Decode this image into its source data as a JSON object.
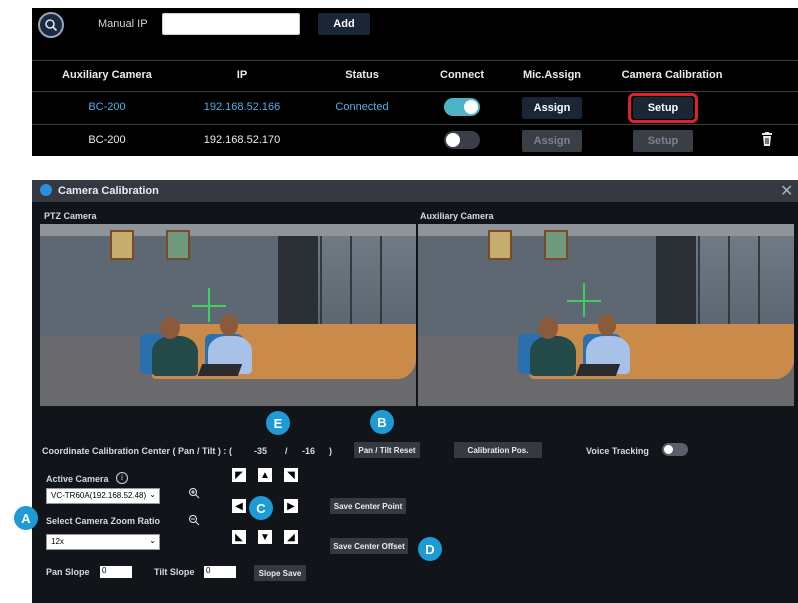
{
  "top_panel": {
    "manual_ip_label": "Manual IP",
    "manual_ip_value": "",
    "add_label": "Add",
    "columns": [
      "Auxiliary Camera",
      "IP",
      "Status",
      "Connect",
      "Mic.Assign",
      "Camera Calibration"
    ],
    "rows": [
      {
        "camera": "BC-200",
        "ip": "192.168.52.166",
        "status": "Connected",
        "connect": true,
        "assign": "Assign",
        "setup": "Setup"
      },
      {
        "camera": "BC-200",
        "ip": "192.168.52.170",
        "status": "",
        "connect": false,
        "assign": "Assign",
        "setup": "Setup"
      }
    ]
  },
  "dialog": {
    "title": "Camera Calibration",
    "ptz_label": "PTZ Camera",
    "aux_label": "Auxiliary Camera",
    "coord_label": "Coordinate Calibration Center ( Pan / Tilt ) :",
    "coord_open": "(",
    "pan_value": "-35",
    "slash": "/",
    "tilt_value": "-16",
    "coord_close": ")",
    "pan_tilt_reset": "Pan / Tilt Reset",
    "calibration_pos": "Calibration Pos.",
    "voice_tracking": "Voice Tracking",
    "active_camera_label": "Active Camera",
    "active_camera_value": "VC-TR60A(192.168.52.48)",
    "zoom_ratio_label": "Select Camera Zoom Ratio",
    "zoom_ratio_value": "12x",
    "save_center_point": "Save Center Point",
    "save_center_offset": "Save Center Offset",
    "pan_slope_label": "Pan Slope",
    "pan_slope_value": "0",
    "tilt_slope_label": "Tilt Slope",
    "tilt_slope_value": "0",
    "slope_save": "Slope Save"
  },
  "callouts": {
    "a": "A",
    "b": "B",
    "c": "C",
    "d": "D",
    "e": "E"
  },
  "colors": {
    "accent": "#1e9ad6",
    "toggle_on": "#4fb3c8",
    "highlight": "#e0202a"
  }
}
